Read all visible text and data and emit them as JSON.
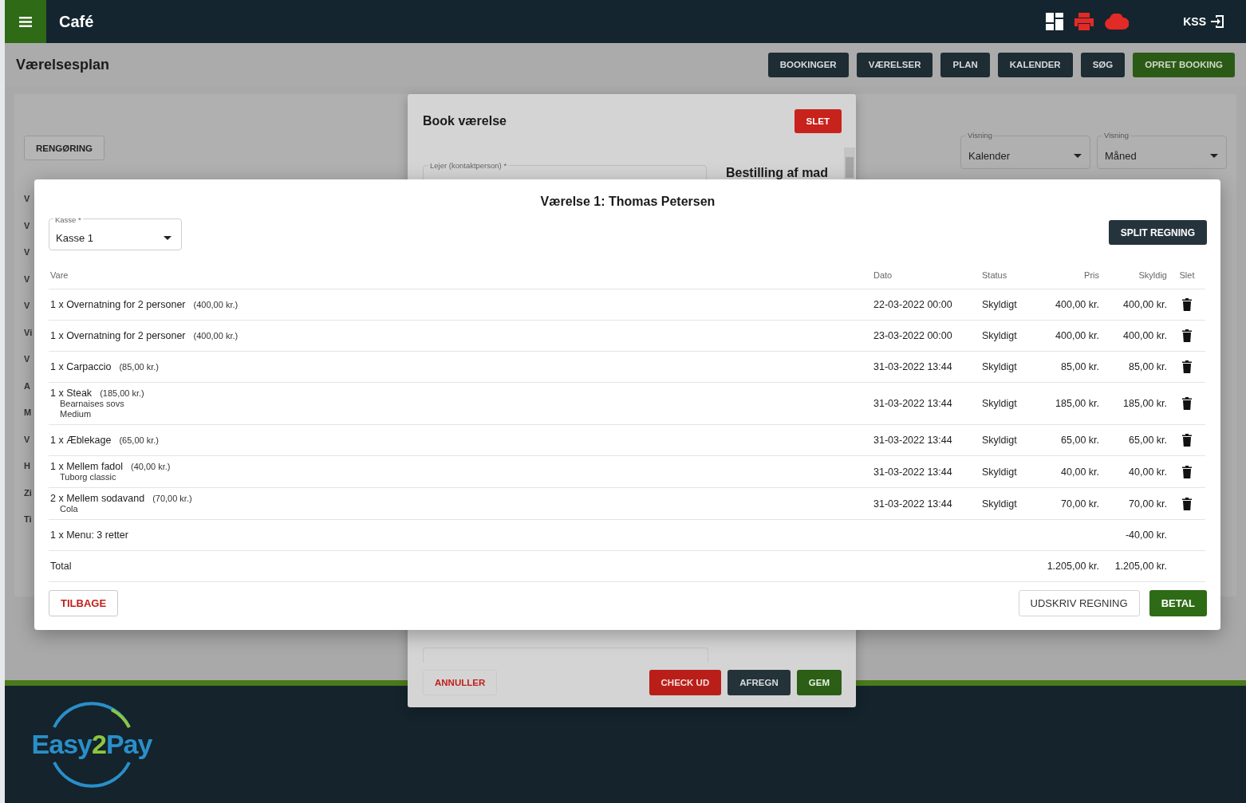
{
  "app_bar": {
    "title": "Café",
    "user": "KSS"
  },
  "page": {
    "title": "Værelsesplan",
    "nav_buttons": [
      {
        "label": "BOOKINGER",
        "kind": "dark"
      },
      {
        "label": "VÆRELSER",
        "kind": "dark"
      },
      {
        "label": "PLAN",
        "kind": "dark"
      },
      {
        "label": "KALENDER",
        "kind": "dark"
      },
      {
        "label": "SØG",
        "kind": "dark"
      },
      {
        "label": "OPRET BOOKING",
        "kind": "primary"
      }
    ]
  },
  "toolbar": {
    "cleaning_button": "RENGØRING",
    "selects": [
      {
        "label": "Visning",
        "value": "Kalender"
      },
      {
        "label": "Visning",
        "value": "Måned"
      }
    ]
  },
  "room_list_fragments": [
    "V",
    "V",
    "V",
    "V",
    "V",
    "Vi",
    "V",
    "A",
    "M",
    "V",
    "H",
    "Zi",
    "Ti"
  ],
  "booking_dialog": {
    "title": "Book værelse",
    "delete_button": "SLET",
    "tenant_field": {
      "label": "Lejer (kontaktperson) *"
    },
    "food_heading": "Bestilling af mad",
    "buttons": [
      {
        "label": "ANNULLER",
        "kind": "outline-danger"
      },
      {
        "label": "CHECK UD",
        "kind": "danger"
      },
      {
        "label": "AFREGN",
        "kind": "dark"
      },
      {
        "label": "GEM",
        "kind": "primary"
      }
    ]
  },
  "bill_dialog": {
    "title": "Værelse 1: Thomas Petersen",
    "register_select": {
      "label": "Kasse *",
      "value": "Kasse 1"
    },
    "split_button": "SPLIT REGNING",
    "columns": [
      "Vare",
      "Dato",
      "Status",
      "Pris",
      "Skyldig",
      "Slet"
    ],
    "rows": [
      {
        "item": "1 x Overnatning for 2 personer",
        "unit_price": "(400,00 kr.)",
        "options": [],
        "date": "22-03-2022 00:00",
        "status": "Skyldigt",
        "price": "400,00 kr.",
        "owed": "400,00 kr.",
        "deletable": true
      },
      {
        "item": "1 x Overnatning for 2 personer",
        "unit_price": "(400,00 kr.)",
        "options": [],
        "date": "23-03-2022 00:00",
        "status": "Skyldigt",
        "price": "400,00 kr.",
        "owed": "400,00 kr.",
        "deletable": true
      },
      {
        "item": "1 x Carpaccio",
        "unit_price": "(85,00 kr.)",
        "options": [],
        "date": "31-03-2022 13:44",
        "status": "Skyldigt",
        "price": "85,00 kr.",
        "owed": "85,00 kr.",
        "deletable": true
      },
      {
        "item": "1 x Steak",
        "unit_price": "(185,00 kr.)",
        "options": [
          "Bearnaises sovs",
          "Medium"
        ],
        "date": "31-03-2022 13:44",
        "status": "Skyldigt",
        "price": "185,00 kr.",
        "owed": "185,00 kr.",
        "deletable": true
      },
      {
        "item": "1 x Æblekage",
        "unit_price": "(65,00 kr.)",
        "options": [],
        "date": "31-03-2022 13:44",
        "status": "Skyldigt",
        "price": "65,00 kr.",
        "owed": "65,00 kr.",
        "deletable": true
      },
      {
        "item": "1 x Mellem fadol",
        "unit_price": "(40,00 kr.)",
        "options": [
          "Tuborg classic"
        ],
        "date": "31-03-2022 13:44",
        "status": "Skyldigt",
        "price": "40,00 kr.",
        "owed": "40,00 kr.",
        "deletable": true
      },
      {
        "item": "2 x Mellem sodavand",
        "unit_price": "(70,00 kr.)",
        "options": [
          "Cola"
        ],
        "date": "31-03-2022 13:44",
        "status": "Skyldigt",
        "price": "70,00 kr.",
        "owed": "70,00 kr.",
        "deletable": true
      },
      {
        "item": "1 x Menu: 3 retter",
        "options": [],
        "owed": "-40,00 kr.",
        "deletable": false
      }
    ],
    "total": {
      "label": "Total",
      "price": "1.205,00 kr.",
      "owed": "1.205,00 kr."
    },
    "buttons": [
      {
        "label": "TILBAGE",
        "kind": "outline-danger"
      },
      {
        "label": "UDSKRIV REGNING",
        "kind": "outline"
      },
      {
        "label": "BETAL",
        "kind": "primary"
      }
    ]
  },
  "footer": {
    "logo_parts": [
      {
        "text": "Easy",
        "color": "#2a8fc9"
      },
      {
        "text": "2",
        "color": "#8dc63f"
      },
      {
        "text": "Pay",
        "color": "#2a8fc9"
      }
    ]
  }
}
